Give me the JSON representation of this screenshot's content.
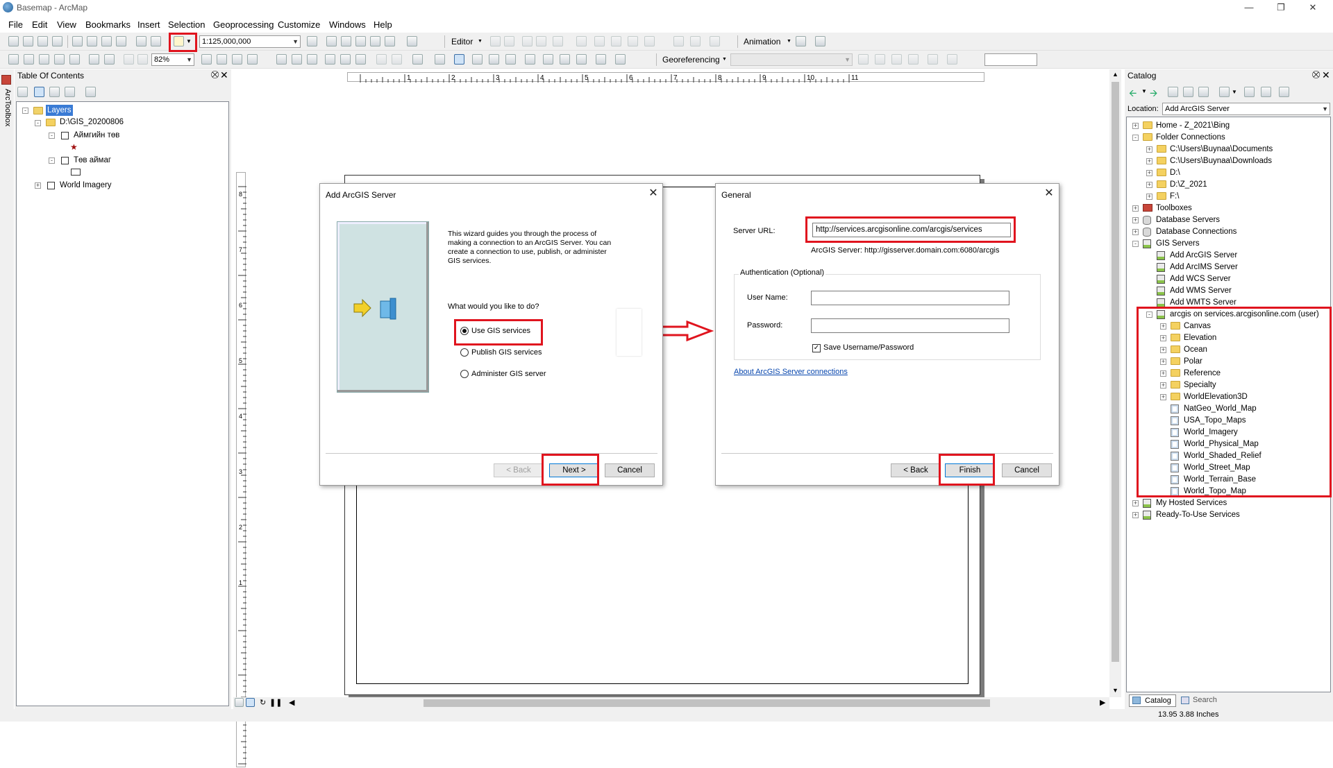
{
  "app": {
    "title": "Basemap - ArcMap"
  },
  "menu": [
    "File",
    "Edit",
    "View",
    "Bookmarks",
    "Insert",
    "Selection",
    "Geoprocessing",
    "Customize",
    "Windows",
    "Help"
  ],
  "toolbar": {
    "scale": "1:125,000,000",
    "zoom": "82%",
    "editor": "Editor",
    "animation": "Animation",
    "georeferencing": "Georeferencing"
  },
  "toc": {
    "title": "Table Of Contents",
    "arctoolbox": "ArcToolbox",
    "layers_label": "Layers",
    "group": "D:\\GIS_20200806",
    "layer1": "Аймгийн төв",
    "layer2": "Төв аймаг",
    "layer3": "World Imagery"
  },
  "dialog1": {
    "title": "Add ArcGIS Server",
    "intro": [
      "This wizard guides you through the process of",
      "making a connection to an ArcGIS Server.  You can",
      "create a connection to use, publish, or administer",
      "GIS services."
    ],
    "question": "What would you like to do?",
    "options": [
      "Use GIS services",
      "Publish GIS services",
      "Administer GIS server"
    ],
    "back": "< Back",
    "next": "Next >",
    "cancel": "Cancel"
  },
  "dialog2": {
    "title": "General",
    "server_url_label": "Server URL:",
    "server_url": "http://services.arcgisonline.com/arcgis/services",
    "example": "ArcGIS Server: http://gisserver.domain.com:6080/arcgis",
    "auth_group": "Authentication (Optional)",
    "user_label": "User Name:",
    "user_value": "",
    "pass_label": "Password:",
    "pass_value": "",
    "save_label": "Save Username/Password",
    "link": "About ArcGIS Server connections",
    "back": "< Back",
    "finish": "Finish",
    "cancel": "Cancel"
  },
  "catalog": {
    "title": "Catalog",
    "location_label": "Location:",
    "location_value": "Add ArcGIS Server",
    "items": [
      {
        "label": "Home - Z_2021\\Bing",
        "level": 0,
        "exp": "+",
        "icon": "folder"
      },
      {
        "label": "Folder Connections",
        "level": 0,
        "exp": "-",
        "icon": "folder"
      },
      {
        "label": "C:\\Users\\Buynaa\\Documents",
        "level": 1,
        "exp": "+",
        "icon": "folder"
      },
      {
        "label": "C:\\Users\\Buynaa\\Downloads",
        "level": 1,
        "exp": "+",
        "icon": "folder"
      },
      {
        "label": "D:\\",
        "level": 1,
        "exp": "+",
        "icon": "folder"
      },
      {
        "label": "D:\\Z_2021",
        "level": 1,
        "exp": "+",
        "icon": "folder"
      },
      {
        "label": "F:\\",
        "level": 1,
        "exp": "+",
        "icon": "folder"
      },
      {
        "label": "Toolboxes",
        "level": 0,
        "exp": "+",
        "icon": "toolbox"
      },
      {
        "label": "Database Servers",
        "level": 0,
        "exp": "+",
        "icon": "db"
      },
      {
        "label": "Database Connections",
        "level": 0,
        "exp": "+",
        "icon": "db"
      },
      {
        "label": "GIS Servers",
        "level": 0,
        "exp": "-",
        "icon": "server"
      },
      {
        "label": "Add ArcGIS Server",
        "level": 1,
        "exp": "",
        "icon": "server"
      },
      {
        "label": "Add ArcIMS Server",
        "level": 1,
        "exp": "",
        "icon": "server"
      },
      {
        "label": "Add WCS Server",
        "level": 1,
        "exp": "",
        "icon": "server"
      },
      {
        "label": "Add WMS Server",
        "level": 1,
        "exp": "",
        "icon": "server"
      },
      {
        "label": "Add WMTS Server",
        "level": 1,
        "exp": "",
        "icon": "server"
      },
      {
        "label": "arcgis on services.arcgisonline.com (user)",
        "level": 1,
        "exp": "-",
        "icon": "server"
      },
      {
        "label": "Canvas",
        "level": 2,
        "exp": "+",
        "icon": "folder"
      },
      {
        "label": "Elevation",
        "level": 2,
        "exp": "+",
        "icon": "folder"
      },
      {
        "label": "Ocean",
        "level": 2,
        "exp": "+",
        "icon": "folder"
      },
      {
        "label": "Polar",
        "level": 2,
        "exp": "+",
        "icon": "folder"
      },
      {
        "label": "Reference",
        "level": 2,
        "exp": "+",
        "icon": "folder"
      },
      {
        "label": "Specialty",
        "level": 2,
        "exp": "+",
        "icon": "folder"
      },
      {
        "label": "WorldElevation3D",
        "level": 2,
        "exp": "+",
        "icon": "folder"
      },
      {
        "label": "NatGeo_World_Map",
        "level": 2,
        "exp": "",
        "icon": "map"
      },
      {
        "label": "USA_Topo_Maps",
        "level": 2,
        "exp": "",
        "icon": "map"
      },
      {
        "label": "World_Imagery",
        "level": 2,
        "exp": "",
        "icon": "map"
      },
      {
        "label": "World_Physical_Map",
        "level": 2,
        "exp": "",
        "icon": "map"
      },
      {
        "label": "World_Shaded_Relief",
        "level": 2,
        "exp": "",
        "icon": "map"
      },
      {
        "label": "World_Street_Map",
        "level": 2,
        "exp": "",
        "icon": "map"
      },
      {
        "label": "World_Terrain_Base",
        "level": 2,
        "exp": "",
        "icon": "map"
      },
      {
        "label": "World_Topo_Map",
        "level": 2,
        "exp": "",
        "icon": "map"
      },
      {
        "label": "My Hosted Services",
        "level": 0,
        "exp": "+",
        "icon": "server"
      },
      {
        "label": "Ready-To-Use Services",
        "level": 0,
        "exp": "+",
        "icon": "server"
      }
    ],
    "tab_catalog": "Catalog",
    "tab_search": "Search"
  },
  "ruler": {
    "h": [
      "1",
      "2",
      "3",
      "4",
      "5",
      "6",
      "7",
      "8",
      "9",
      "10",
      "11"
    ],
    "v": [
      "8",
      "7",
      "6",
      "5",
      "4",
      "3",
      "2",
      "1"
    ]
  },
  "status": {
    "coords": "13.95  3.88 Inches"
  }
}
